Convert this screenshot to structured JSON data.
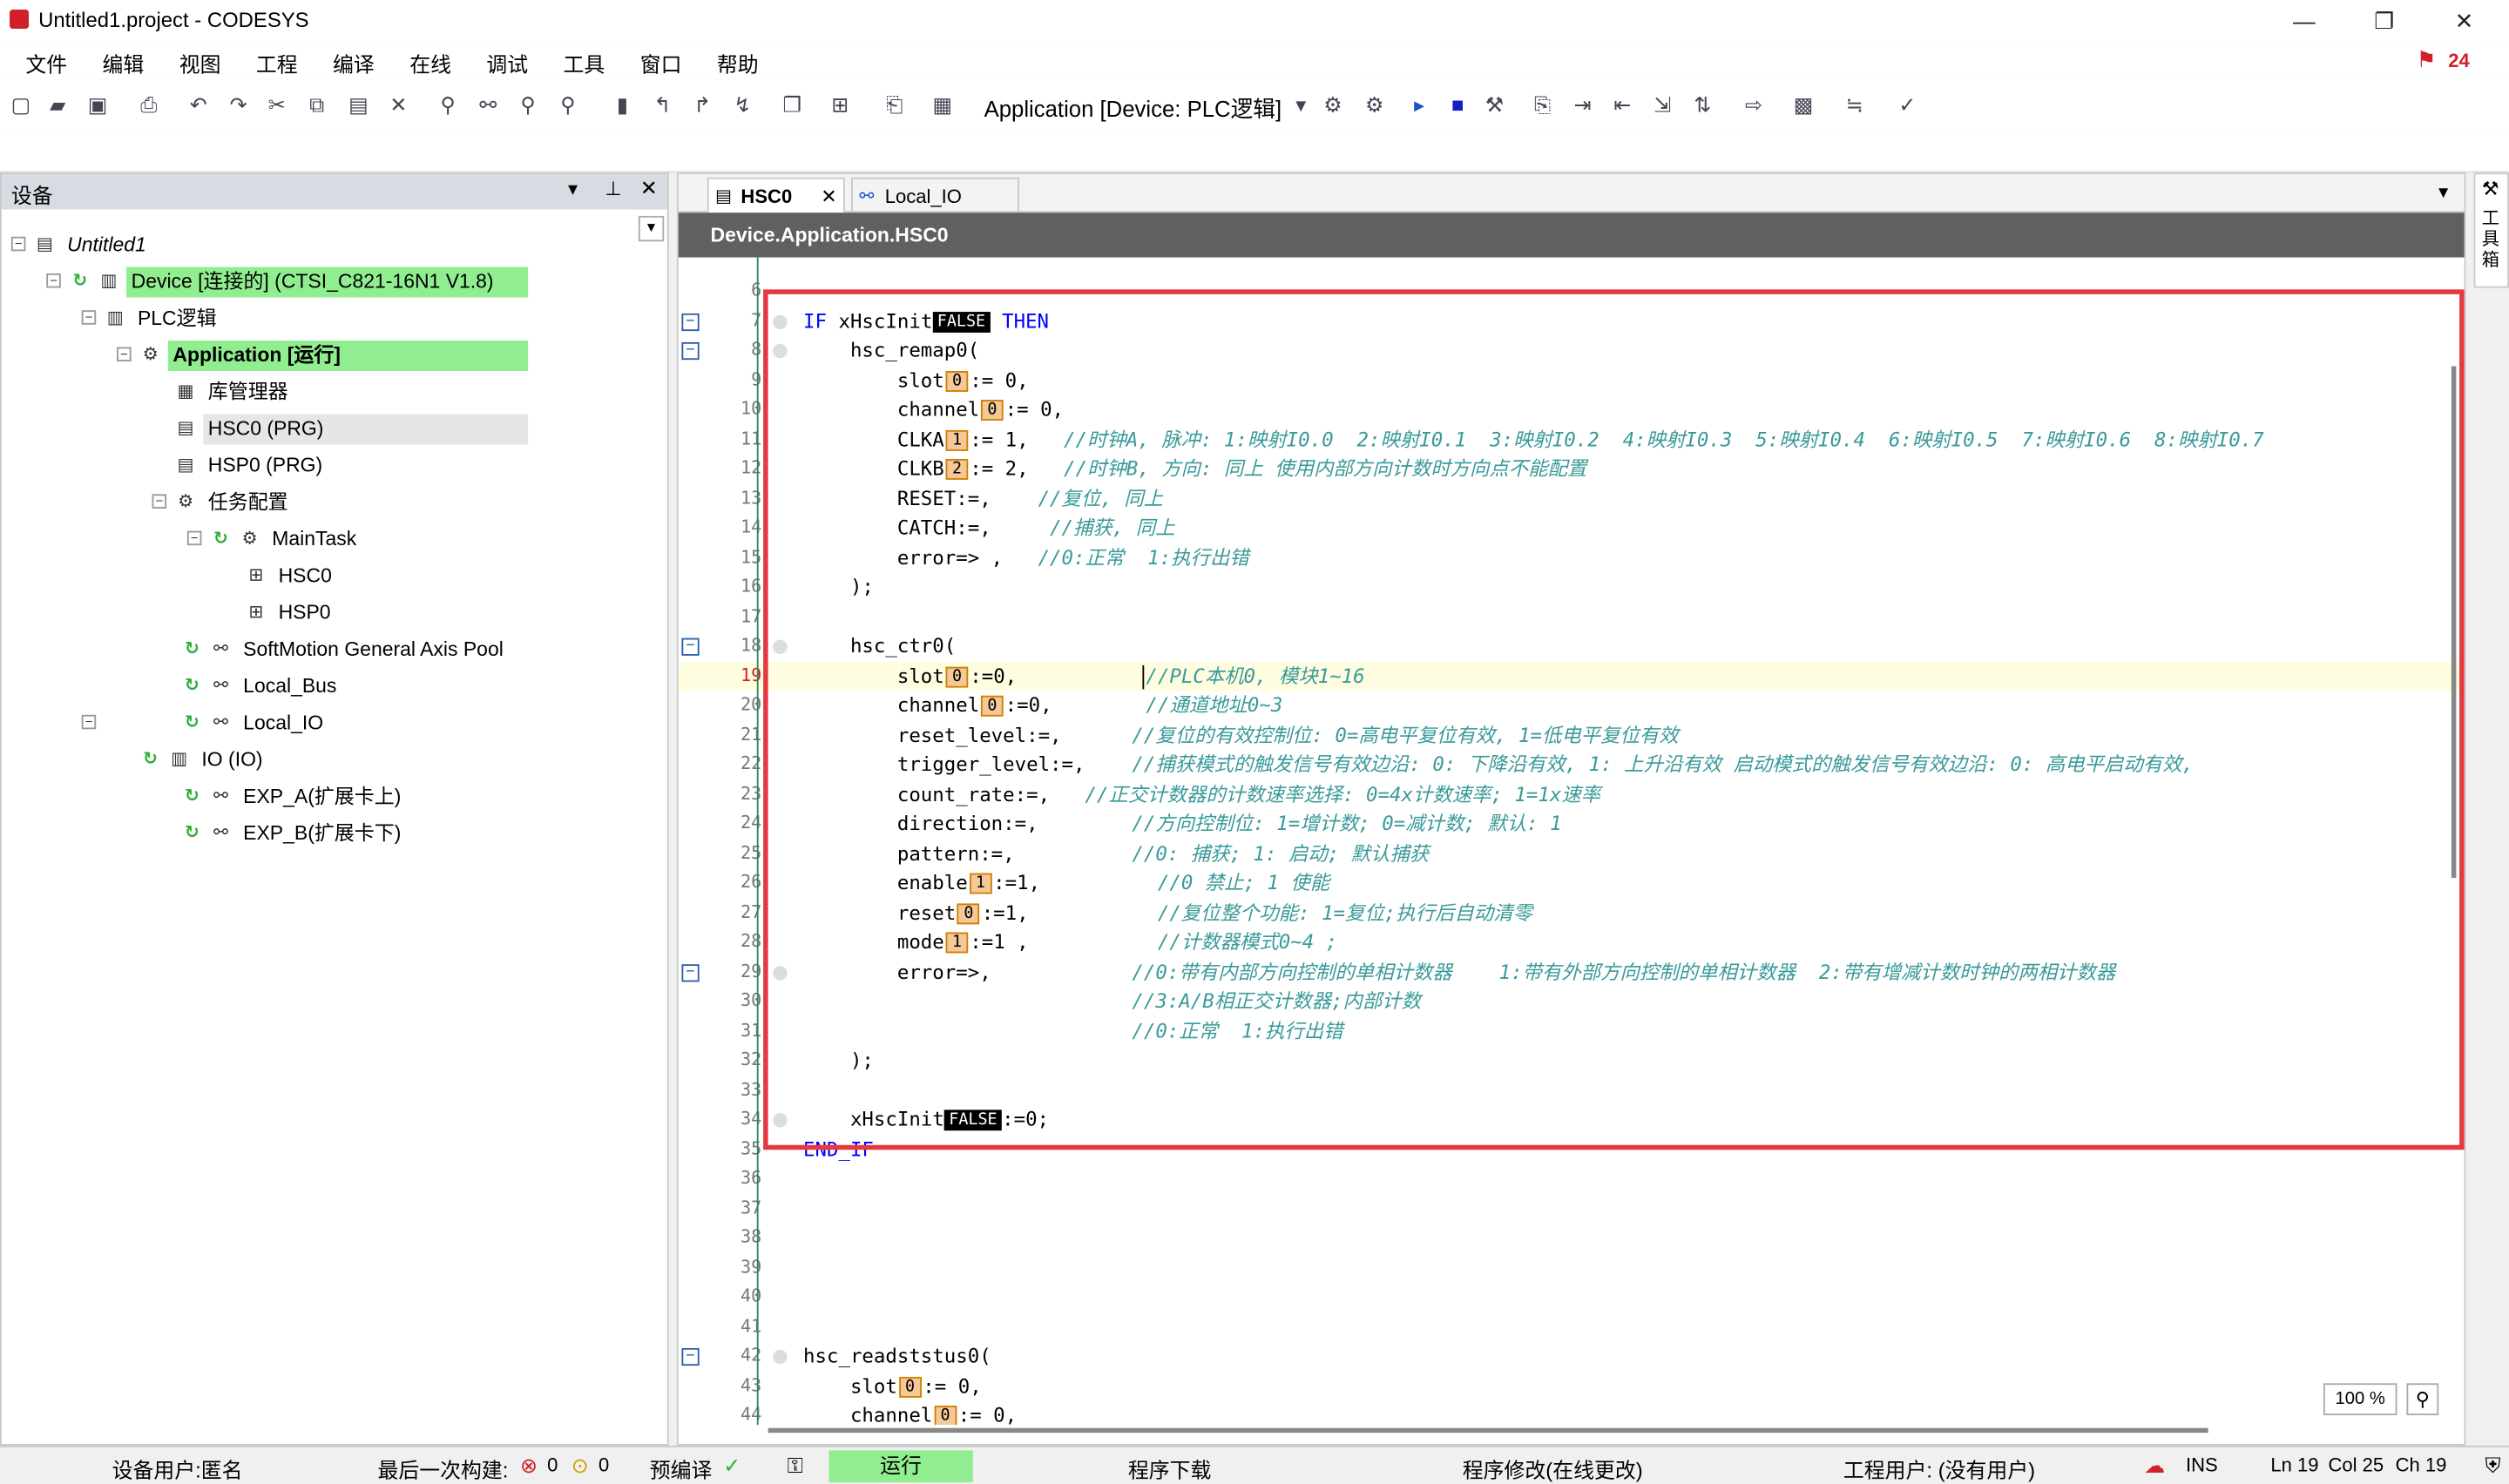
{
  "window": {
    "title": "Untitled1.project - CODESYS",
    "minimize": "—",
    "maximize": "❐",
    "close": "✕"
  },
  "menu": [
    "文件",
    "编辑",
    "视图",
    "工程",
    "编译",
    "在线",
    "调试",
    "工具",
    "窗口",
    "帮助"
  ],
  "notifications": {
    "count": "24"
  },
  "toolbar": {
    "application_selector": "Application [Device: PLC逻辑]"
  },
  "devices_panel": {
    "title": "设备",
    "tree": [
      {
        "label": "Untitled1",
        "icon": "project-icon",
        "level": 0,
        "highlight": false,
        "italic": true
      },
      {
        "label": "Device [连接的] (CTSI_C821-16N1 V1.8)",
        "icon": "device-icon",
        "level": 1,
        "highlight": true,
        "italic": false
      },
      {
        "label": "PLC逻辑",
        "icon": "plc-logic-icon",
        "level": 2,
        "highlight": false,
        "italic": false
      },
      {
        "label": "Application [运行]",
        "icon": "application-icon",
        "level": 3,
        "highlight": true,
        "italic": false
      },
      {
        "label": "库管理器",
        "icon": "library-icon",
        "level": 4,
        "highlight": false,
        "italic": false
      },
      {
        "label": "HSC0 (PRG)",
        "icon": "pou-icon",
        "level": 4,
        "highlight": false,
        "italic": false,
        "selected": true
      },
      {
        "label": "HSP0 (PRG)",
        "icon": "pou-icon",
        "level": 4,
        "highlight": false,
        "italic": false
      },
      {
        "label": "任务配置",
        "icon": "task-config-icon",
        "level": 4,
        "highlight": false,
        "italic": false
      },
      {
        "label": "MainTask",
        "icon": "task-icon",
        "level": 5,
        "highlight": false,
        "italic": false
      },
      {
        "label": "HSC0",
        "icon": "program-call-icon",
        "level": 6,
        "highlight": false,
        "italic": false
      },
      {
        "label": "HSP0",
        "icon": "program-call-icon",
        "level": 6,
        "highlight": false,
        "italic": false
      },
      {
        "label": "SoftMotion General Axis Pool",
        "icon": "axis-pool-icon",
        "level": 2,
        "highlight": false,
        "italic": false
      },
      {
        "label": "Local_Bus",
        "icon": "bus-icon",
        "level": 2,
        "highlight": false,
        "italic": false
      },
      {
        "label": "Local_IO",
        "icon": "bus-icon",
        "level": 2,
        "highlight": false,
        "italic": false
      },
      {
        "label": "IO (IO)",
        "icon": "io-icon",
        "level": 3,
        "highlight": false,
        "italic": false
      },
      {
        "label": "EXP_A(扩展卡上)",
        "icon": "bus-icon",
        "level": 2,
        "highlight": false,
        "italic": false
      },
      {
        "label": "EXP_B(扩展卡下)",
        "icon": "bus-icon",
        "level": 2,
        "highlight": false,
        "italic": false
      }
    ]
  },
  "editor": {
    "tabs": [
      {
        "label": "HSC0",
        "active": true
      },
      {
        "label": "Local_IO",
        "active": false
      }
    ],
    "path": "Device.Application.HSC0",
    "zoom": "100 %",
    "lines": [
      {
        "n": "6",
        "segs": []
      },
      {
        "n": "7",
        "fold": true,
        "segs": [
          {
            "t": "IF ",
            "c": "kw"
          },
          {
            "t": "xHscInit",
            "c": ""
          },
          {
            "t": "FALSE",
            "c": "bool"
          },
          {
            "t": " THEN",
            "c": "kw"
          }
        ]
      },
      {
        "n": "8",
        "fold": true,
        "segs": [
          {
            "t": "    hsc_remap0(",
            "c": ""
          }
        ]
      },
      {
        "n": "9",
        "segs": [
          {
            "t": "        slot",
            "c": ""
          },
          {
            "t": "0",
            "c": "val"
          },
          {
            "t": ":= 0,",
            "c": ""
          }
        ]
      },
      {
        "n": "10",
        "segs": [
          {
            "t": "        channel",
            "c": ""
          },
          {
            "t": "0",
            "c": "val"
          },
          {
            "t": ":= 0,",
            "c": ""
          }
        ]
      },
      {
        "n": "11",
        "segs": [
          {
            "t": "        CLKA",
            "c": ""
          },
          {
            "t": "1",
            "c": "val"
          },
          {
            "t": ":= 1,   ",
            "c": ""
          },
          {
            "t": "//时钟A, 脉冲: 1:映射I0.0  2:映射I0.1  3:映射I0.2  4:映射I0.3  5:映射I0.4  6:映射I0.5  7:映射I0.6  8:映射I0.7",
            "c": "cm"
          }
        ]
      },
      {
        "n": "12",
        "segs": [
          {
            "t": "        CLKB",
            "c": ""
          },
          {
            "t": "2",
            "c": "val"
          },
          {
            "t": ":= 2,   ",
            "c": ""
          },
          {
            "t": "//时钟B, 方向: 同上 使用内部方向计数时方向点不能配置",
            "c": "cm"
          }
        ]
      },
      {
        "n": "13",
        "segs": [
          {
            "t": "        RESET:=,    ",
            "c": ""
          },
          {
            "t": "//复位, 同上",
            "c": "cm"
          }
        ]
      },
      {
        "n": "14",
        "segs": [
          {
            "t": "        CATCH:=,     ",
            "c": ""
          },
          {
            "t": "//捕获, 同上",
            "c": "cm"
          }
        ]
      },
      {
        "n": "15",
        "segs": [
          {
            "t": "        error=> ,   ",
            "c": ""
          },
          {
            "t": "//0:正常  1:执行出错",
            "c": "cm"
          }
        ]
      },
      {
        "n": "16",
        "segs": [
          {
            "t": "    );",
            "c": ""
          }
        ]
      },
      {
        "n": "17",
        "segs": []
      },
      {
        "n": "18",
        "fold": true,
        "segs": [
          {
            "t": "    hsc_ctr0(",
            "c": ""
          }
        ]
      },
      {
        "n": "19",
        "current": true,
        "segs": [
          {
            "t": "        slot",
            "c": ""
          },
          {
            "t": "0",
            "c": "val"
          },
          {
            "t": ":=0,           ",
            "c": ""
          },
          {
            "t": "//PLC本机0, 模块1~16",
            "c": "cm"
          }
        ]
      },
      {
        "n": "20",
        "segs": [
          {
            "t": "        channel",
            "c": ""
          },
          {
            "t": "0",
            "c": "val"
          },
          {
            "t": ":=0,        ",
            "c": ""
          },
          {
            "t": "//通道地址0~3",
            "c": "cm"
          }
        ]
      },
      {
        "n": "21",
        "segs": [
          {
            "t": "        reset_level:=,      ",
            "c": ""
          },
          {
            "t": "//复位的有效控制位: 0=高电平复位有效, 1=低电平复位有效",
            "c": "cm"
          }
        ]
      },
      {
        "n": "22",
        "segs": [
          {
            "t": "        trigger_level:=,    ",
            "c": ""
          },
          {
            "t": "//捕获模式的触发信号有效边沿: 0: 下降沿有效, 1: 上升沿有效 启动模式的触发信号有效边沿: 0: 高电平启动有效,",
            "c": "cm"
          }
        ]
      },
      {
        "n": "23",
        "segs": [
          {
            "t": "        count_rate:=,   ",
            "c": ""
          },
          {
            "t": "//正交计数器的计数速率选择: 0=4x计数速率; 1=1x速率",
            "c": "cm"
          }
        ]
      },
      {
        "n": "24",
        "segs": [
          {
            "t": "        direction:=,        ",
            "c": ""
          },
          {
            "t": "//方向控制位: 1=增计数; 0=减计数; 默认: 1",
            "c": "cm"
          }
        ]
      },
      {
        "n": "25",
        "segs": [
          {
            "t": "        pattern:=,          ",
            "c": ""
          },
          {
            "t": "//0: 捕获; 1: 启动; 默认捕获",
            "c": "cm"
          }
        ]
      },
      {
        "n": "26",
        "segs": [
          {
            "t": "        enable",
            "c": ""
          },
          {
            "t": "1",
            "c": "val"
          },
          {
            "t": ":=1,          ",
            "c": ""
          },
          {
            "t": "//0 禁止; 1 使能",
            "c": "cm"
          }
        ]
      },
      {
        "n": "27",
        "segs": [
          {
            "t": "        reset",
            "c": ""
          },
          {
            "t": "0",
            "c": "val"
          },
          {
            "t": ":=1,           ",
            "c": ""
          },
          {
            "t": "//复位整个功能: 1=复位;执行后自动清零",
            "c": "cm"
          }
        ]
      },
      {
        "n": "28",
        "segs": [
          {
            "t": "        mode",
            "c": ""
          },
          {
            "t": "1",
            "c": "val"
          },
          {
            "t": ":=1 ,           ",
            "c": ""
          },
          {
            "t": "//计数器模式0~4 ;",
            "c": "cm"
          }
        ]
      },
      {
        "n": "29",
        "fold": true,
        "segs": [
          {
            "t": "        error=>,            ",
            "c": ""
          },
          {
            "t": "//0:带有内部方向控制的单相计数器    1:带有外部方向控制的单相计数器  2:带有增减计数时钟的两相计数器",
            "c": "cm"
          }
        ]
      },
      {
        "n": "30",
        "segs": [
          {
            "t": "                            ",
            "c": ""
          },
          {
            "t": "//3:A/B相正交计数器;内部计数",
            "c": "cm"
          }
        ]
      },
      {
        "n": "31",
        "segs": [
          {
            "t": "                            ",
            "c": ""
          },
          {
            "t": "//0:正常  1:执行出错",
            "c": "cm"
          }
        ]
      },
      {
        "n": "32",
        "segs": [
          {
            "t": "    );",
            "c": ""
          }
        ]
      },
      {
        "n": "33",
        "segs": []
      },
      {
        "n": "34",
        "segs": [
          {
            "t": "    xHscInit",
            "c": ""
          },
          {
            "t": "FALSE",
            "c": "bool"
          },
          {
            "t": ":=0;",
            "c": ""
          }
        ]
      },
      {
        "n": "35",
        "segs": [
          {
            "t": "END_IF",
            "c": "kw"
          }
        ]
      },
      {
        "n": "36",
        "segs": []
      },
      {
        "n": "37",
        "segs": []
      },
      {
        "n": "38",
        "segs": []
      },
      {
        "n": "39",
        "segs": []
      },
      {
        "n": "40",
        "segs": []
      },
      {
        "n": "41",
        "segs": []
      },
      {
        "n": "42",
        "fold": true,
        "segs": [
          {
            "t": "hsc_readststus0(",
            "c": ""
          }
        ]
      },
      {
        "n": "43",
        "segs": [
          {
            "t": "    slot",
            "c": ""
          },
          {
            "t": "0",
            "c": "val"
          },
          {
            "t": ":= 0,",
            "c": ""
          }
        ]
      },
      {
        "n": "44",
        "segs": [
          {
            "t": "    channel",
            "c": ""
          },
          {
            "t": "0",
            "c": "val"
          },
          {
            "t": ":= 0,",
            "c": ""
          }
        ]
      }
    ]
  },
  "right_panel": {
    "label": "工具箱"
  },
  "statusbar": {
    "device_user": "设备用户:匿名",
    "last_build": "最后一次构建:",
    "errors": "0",
    "warnings": "0",
    "precompile": "预编译",
    "run_state": "运行",
    "download": "程序下载",
    "online_change": "程序修改(在线更改)",
    "project_user": "工程用户: (没有用户)",
    "ins": "INS",
    "ln": "Ln 19",
    "col": "Col 25",
    "ch": "Ch 19"
  },
  "colors": {
    "highlight_box": "#e5393f",
    "connected_green": "#90ee90",
    "keyword": "#0000ff",
    "comment": "#3a9a9a"
  }
}
